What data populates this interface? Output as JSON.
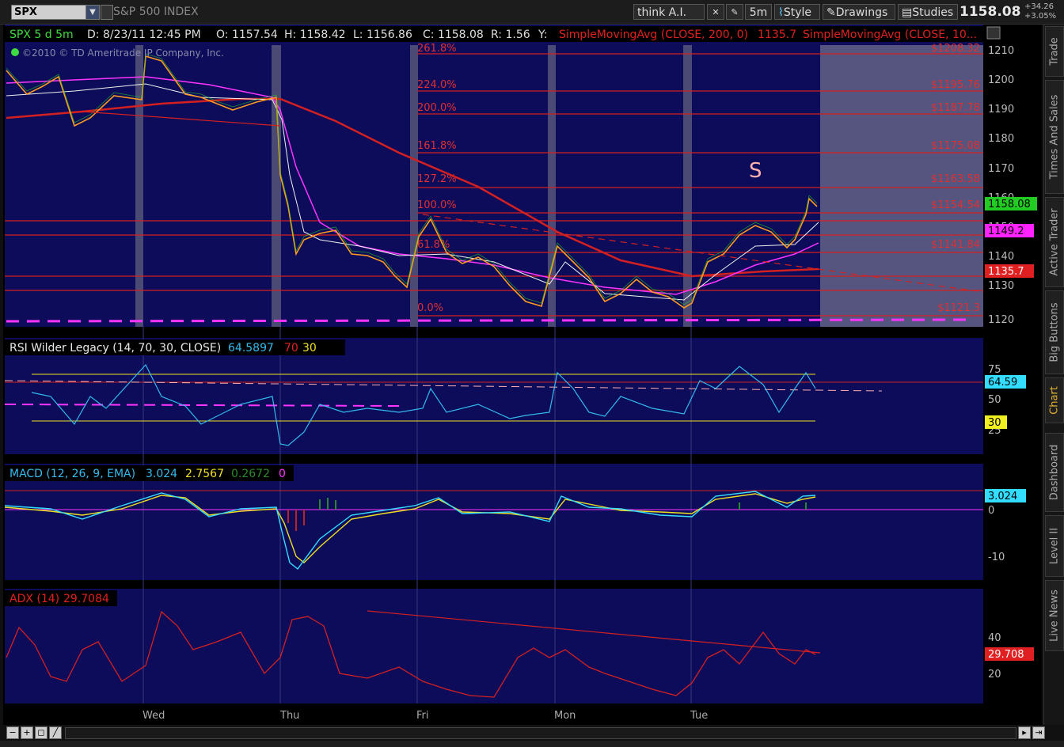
{
  "toolbar": {
    "symbol": "SPX",
    "description": "S&P 500 INDEX",
    "think_ai": "think A.I.",
    "timeframe": "5m",
    "style": "Style",
    "drawings": "Drawings",
    "studies": "Studies",
    "last_price": "1158.08",
    "change_pts": "+34.26",
    "change_pct": "+3.05%"
  },
  "info": {
    "title": "SPX 5 d 5m",
    "date": "D: 8/23/11 12:45 PM",
    "open": "O: 1157.54",
    "high": "H: 1158.42",
    "low": "L: 1156.86",
    "close": "C: 1158.08",
    "range": "R: 1.56",
    "y": "Y:",
    "sma200": "SimpleMovingAvg (CLOSE, 200, 0)",
    "sma200_val": "1135.7",
    "sma_other": "SimpleMovingAvg (CLOSE, 10...",
    "copyright": "©2010 © TD Ameritrade IP Company, Inc.",
    "annotation": "S"
  },
  "price_axis": {
    "ticks": [
      "1210",
      "1200",
      "1190",
      "1180",
      "1170",
      "1160",
      "1150",
      "1140",
      "1130",
      "1120"
    ],
    "badge_last": "1158.08",
    "badge_ma": "1149.2",
    "badge_sma200": "1135.7"
  },
  "fib": [
    {
      "pct": "261.8%",
      "price": "$1208.32"
    },
    {
      "pct": "224.0%",
      "price": "$1195.76"
    },
    {
      "pct": "200.0%",
      "price": "$1187.78"
    },
    {
      "pct": "161.8%",
      "price": "$1175.08"
    },
    {
      "pct": "127.2%",
      "price": "$1163.58"
    },
    {
      "pct": "100.0%",
      "price": "$1154.54"
    },
    {
      "pct": "61.8%",
      "price": "$1141.84"
    },
    {
      "pct": "0.0%",
      "price": "$1121.3"
    }
  ],
  "days": [
    "Wed",
    "Thu",
    "Fri",
    "Mon",
    "Tue"
  ],
  "rsi": {
    "label": "RSI Wilder Legacy (14, 70, 30, CLOSE)",
    "value": "64.5897",
    "ob": "70",
    "os": "30",
    "ticks": [
      "75",
      "50",
      "25"
    ],
    "badge_value": "64.59",
    "badge_os": "30"
  },
  "macd": {
    "label": "MACD (12, 26, 9, EMA)",
    "v1": "3.024",
    "v2": "2.7567",
    "v3": "0.2672",
    "v4": "0",
    "ticks": [
      "0",
      "-10"
    ],
    "badge": "3.024"
  },
  "adx": {
    "label": "ADX (14)",
    "value": "29.7084",
    "ticks": [
      "40",
      "20"
    ],
    "badge": "29.708"
  },
  "side_tabs": [
    "Trade",
    "Times And Sales",
    "Active Trader",
    "Big Buttons",
    "Chart",
    "Dashboard",
    "Level II",
    "Live News"
  ],
  "colors": {
    "panel_bg": "#0c0c5a",
    "fib_red": "#e02020",
    "last_green": "#22cc22",
    "ma_magenta": "#ff22ff",
    "rsi_cyan": "#33bbee",
    "macd_yellow": "#f0e020"
  }
}
